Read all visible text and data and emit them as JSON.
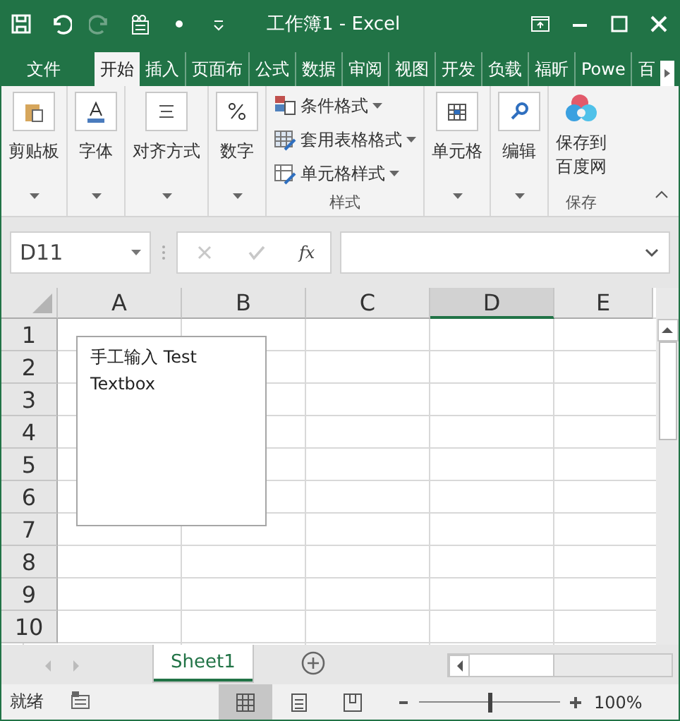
{
  "window": {
    "title": "工作簿1 - Excel"
  },
  "tabs": [
    {
      "label": "文件",
      "selected": false,
      "kind": "file"
    },
    {
      "label": "开始",
      "selected": true,
      "kind": "tab"
    },
    {
      "label": "插入",
      "selected": false,
      "kind": "tab"
    },
    {
      "label": "页面布",
      "selected": false,
      "kind": "tab"
    },
    {
      "label": "公式",
      "selected": false,
      "kind": "tab"
    },
    {
      "label": "数据",
      "selected": false,
      "kind": "tab"
    },
    {
      "label": "审阅",
      "selected": false,
      "kind": "tab"
    },
    {
      "label": "视图",
      "selected": false,
      "kind": "tab"
    },
    {
      "label": "开发",
      "selected": false,
      "kind": "tab"
    },
    {
      "label": "负载",
      "selected": false,
      "kind": "tab"
    },
    {
      "label": "福昕",
      "selected": false,
      "kind": "tab"
    },
    {
      "label": "Powe",
      "selected": false,
      "kind": "tab"
    },
    {
      "label": "百",
      "selected": false,
      "kind": "tab"
    }
  ],
  "ribbon": {
    "groups": [
      {
        "kind": "collapsed",
        "label": "剪贴板"
      },
      {
        "kind": "collapsed",
        "label": "字体"
      },
      {
        "kind": "collapsed",
        "label": "对齐方式"
      },
      {
        "kind": "collapsed",
        "label": "数字"
      },
      {
        "kind": "stack",
        "label": "样式",
        "items": [
          "条件格式",
          "套用表格格式",
          "单元格样式"
        ]
      },
      {
        "kind": "collapsed",
        "label": "单元格"
      },
      {
        "kind": "collapsed",
        "label": "编辑"
      },
      {
        "kind": "cloud",
        "label": "保存",
        "lines": [
          "保存到",
          "百度网"
        ]
      }
    ]
  },
  "formula_bar": {
    "name_box": "D11",
    "fx": "fx"
  },
  "columns": [
    {
      "label": "A",
      "selected": false
    },
    {
      "label": "B",
      "selected": false
    },
    {
      "label": "C",
      "selected": false
    },
    {
      "label": "D",
      "selected": true
    },
    {
      "label": "E",
      "selected": false
    }
  ],
  "rows": [
    "1",
    "2",
    "3",
    "4",
    "5",
    "6",
    "7",
    "8",
    "9",
    "10"
  ],
  "textbox": {
    "text": "手工输入 Test Textbox"
  },
  "sheet_tabs": [
    {
      "label": "Sheet1",
      "selected": true
    }
  ],
  "status_bar": {
    "status": "就绪",
    "views": [
      {
        "selected": true
      },
      {
        "selected": false
      },
      {
        "selected": false
      }
    ],
    "zoom": {
      "level": 0.5,
      "reading": "100%"
    }
  }
}
